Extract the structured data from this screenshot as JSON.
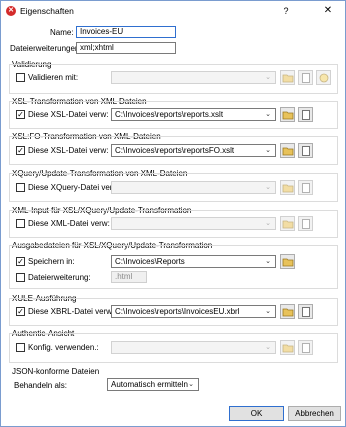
{
  "window": {
    "title": "Eigenschaften",
    "help": "?",
    "close": "✕"
  },
  "name": {
    "label": "Name:",
    "value": "Invoices-EU"
  },
  "extensions": {
    "label": "Dateierweiterungen:",
    "value": "xml;xhtml"
  },
  "validation": {
    "group": "Validierung",
    "checkbox": "Validieren mit:",
    "checked": false
  },
  "xsl": {
    "group": "XSL-Transformation von XML Dateien",
    "checkbox": "Diese XSL-Datei verw:",
    "checked": true,
    "value": "C:\\Invoices\\reports\\reports.xslt"
  },
  "xslfo": {
    "group": "XSL:FO-Transformation von XML-Dateien",
    "checkbox": "Diese XSL-Datei verw:",
    "checked": true,
    "value": "C:\\Invoices\\reports\\reportsFO.xslt"
  },
  "xquery": {
    "group": "XQuery/Update-Transformation von XML-Dateien",
    "checkbox": "Diese XQuery-Datei verw:",
    "checked": false
  },
  "xmlinput": {
    "group": "XML-Input für XSL/XQuery/Update-Transformation",
    "checkbox": "Diese XML-Datei verw:",
    "checked": false
  },
  "output": {
    "group": "Ausgabedateien für XSL/XQuery/Update-Transformation",
    "save_checkbox": "Speichern in:",
    "save_checked": true,
    "save_value": "C:\\Invoices\\Reports",
    "ext_checkbox": "Dateierweiterung:",
    "ext_checked": false,
    "ext_value": ".html"
  },
  "xule": {
    "group": "XULE-Ausführung",
    "checkbox": "Diese XBRL-Datei verw:",
    "checked": true,
    "value": "C:\\Invoices\\reports\\InvoicesEU.xbrl"
  },
  "authentic": {
    "group": "Authentic-Ansicht",
    "checkbox": "Konfig. verwenden.:",
    "checked": false
  },
  "json": {
    "group": "JSON-konforme Dateien",
    "label": "Behandeln als:",
    "value": "Automatisch ermitteln"
  },
  "buttons": {
    "ok": "OK",
    "cancel": "Abbrechen"
  },
  "glyphs": {
    "check": "✓",
    "arrow": "⌄"
  }
}
